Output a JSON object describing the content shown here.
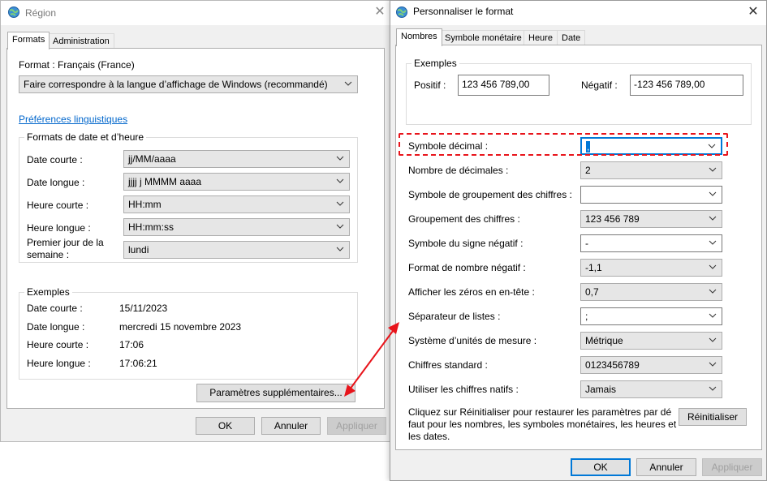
{
  "region": {
    "title": "Région",
    "tabs": [
      "Formats",
      "Administration"
    ],
    "format_label": "Format : Français (France)",
    "format_value": "Faire correspondre à la langue d’affichage de Windows (recommandé)",
    "lang_prefs_link": "Préférences linguistiques",
    "date_time_group": "Formats de date et d’heure",
    "fields": [
      {
        "label": "Date courte :",
        "value": "jj/MM/aaaa"
      },
      {
        "label": "Date longue :",
        "value": "jjjj j MMMM aaaa"
      },
      {
        "label": "Heure courte :",
        "value": "HH:mm"
      },
      {
        "label": "Heure longue :",
        "value": "HH:mm:ss"
      },
      {
        "label": "Premier jour de la semaine :",
        "value": "lundi"
      }
    ],
    "examples_group": "Exemples",
    "examples": [
      {
        "label": "Date courte :",
        "value": "15/11/2023"
      },
      {
        "label": "Date longue :",
        "value": "mercredi 15 novembre 2023"
      },
      {
        "label": "Heure courte :",
        "value": "17:06"
      },
      {
        "label": "Heure longue :",
        "value": "17:06:21"
      }
    ],
    "additional_settings_button": "Paramètres supplémentaires...",
    "ok": "OK",
    "cancel": "Annuler",
    "apply": "Appliquer"
  },
  "perso": {
    "title": "Personnaliser le format",
    "tabs": [
      "Nombres",
      "Symbole monétaire",
      "Heure",
      "Date"
    ],
    "examples_group": "Exemples",
    "positive_label": "Positif :",
    "positive_value": "123 456 789,00",
    "negative_label": "Négatif :",
    "negative_value": "-123 456 789,00",
    "settings": [
      {
        "label": "Symbole décimal :",
        "value": ","
      },
      {
        "label": "Nombre de décimales :",
        "value": "2"
      },
      {
        "label": "Symbole de groupement des chiffres :",
        "value": ""
      },
      {
        "label": "Groupement des chiffres :",
        "value": "123 456 789"
      },
      {
        "label": "Symbole du signe négatif :",
        "value": "-"
      },
      {
        "label": "Format de nombre négatif :",
        "value": "-1,1"
      },
      {
        "label": "Afficher les zéros en en-tête :",
        "value": "0,7"
      },
      {
        "label": "Séparateur de listes :",
        "value": ";"
      },
      {
        "label": "Système d’unités de mesure :",
        "value": "Métrique"
      },
      {
        "label": "Chiffres standard :",
        "value": "0123456789"
      },
      {
        "label": "Utiliser les chiffres natifs :",
        "value": "Jamais"
      }
    ],
    "reset_text_1": "Cliquez sur Réinitialiser pour restaurer les paramètres par dé",
    "reset_text_2": "faut pour les nombres, les symboles monétaires, les heures et",
    "reset_text_3": "les dates.",
    "reset_button": "Réinitialiser",
    "ok": "OK",
    "cancel": "Annuler",
    "apply": "Appliquer"
  },
  "colors": {
    "highlight": "#e8141b",
    "link": "#0066cc",
    "focus": "#0078d7"
  }
}
